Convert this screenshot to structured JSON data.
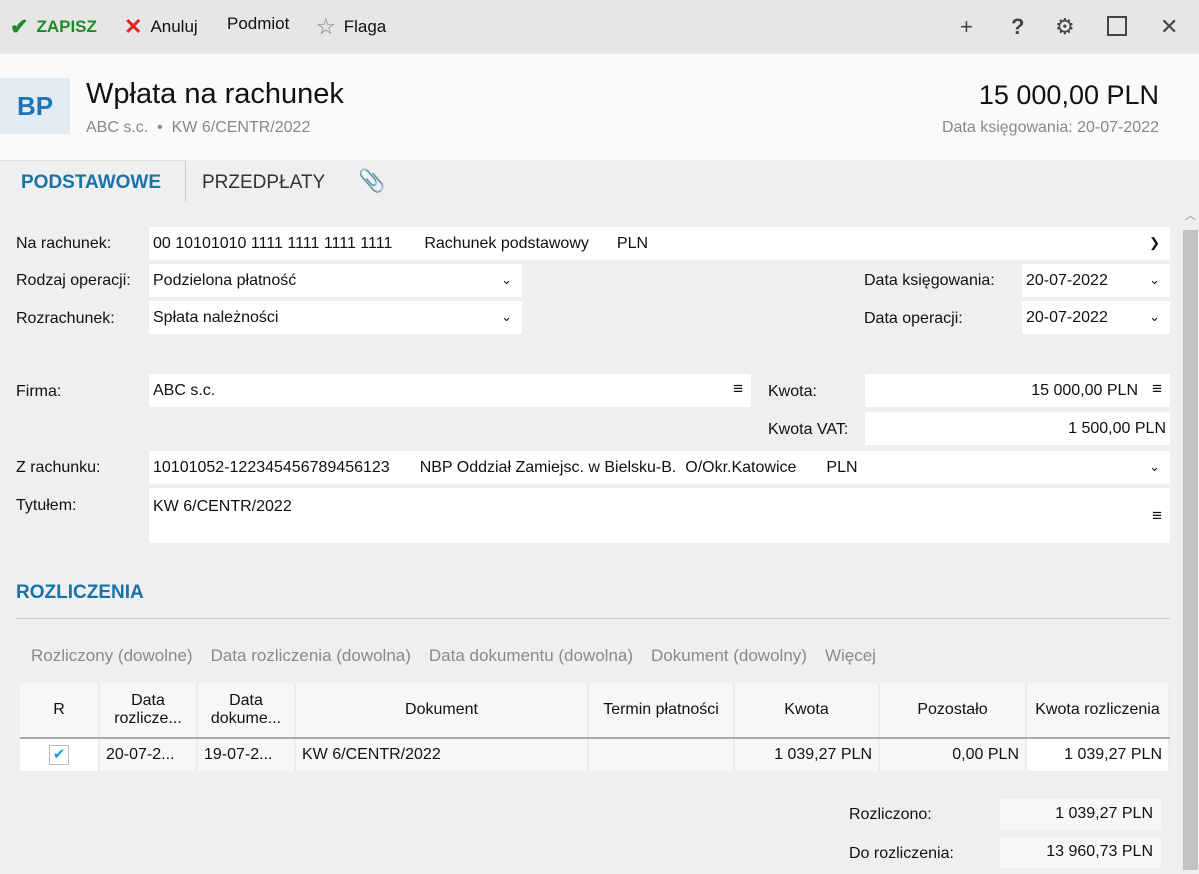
{
  "toolbar": {
    "save": "ZAPISZ",
    "cancel": "Anuluj",
    "subject": "Podmiot",
    "flag": "Flaga"
  },
  "header": {
    "badge": "BP",
    "title": "Wpłata na rachunek",
    "company": "ABC s.c.",
    "doc_number": "KW 6/CENTR/2022",
    "amount": "15 000,00 PLN",
    "posting_date": "Data księgowania: 20-07-2022"
  },
  "tabs": [
    "PODSTAWOWE",
    "PRZEDPŁATY"
  ],
  "form": {
    "account_label": "Na rachunek:",
    "account_number": "00 10101010 1111 1111 1111 1111",
    "account_name": "Rachunek podstawowy",
    "account_currency": "PLN",
    "operation_label": "Rodzaj operacji:",
    "operation_value": "Podzielona płatność",
    "settlement_label": "Rozrachunek:",
    "settlement_value": "Spłata należności",
    "posting_date_label": "Data księgowania:",
    "posting_date_value": "20-07-2022",
    "operation_date_label": "Data operacji:",
    "operation_date_value": "20-07-2022",
    "company_label": "Firma:",
    "company_value": "ABC s.c.",
    "amount_label": "Kwota:",
    "amount_value": "15 000,00 PLN",
    "vat_label": "Kwota VAT:",
    "vat_value": "1 500,00 PLN",
    "from_account_label": "Z rachunku:",
    "from_account_number": "10101052-122345456789456123",
    "from_account_bank": "NBP Oddział Zamiejsc. w Bielsku-B.  O/Okr.Katowice",
    "from_account_currency": "PLN",
    "title_label": "Tytułem:",
    "title_value": "KW 6/CENTR/2022"
  },
  "settlements": {
    "heading": "ROZLICZENIA",
    "filters": [
      "Rozliczony (dowolne)",
      "Data rozliczenia (dowolna)",
      "Data dokumentu (dowolna)",
      "Dokument (dowolny)",
      "Więcej"
    ],
    "columns": [
      "R",
      "Data rozlicze...",
      "Data dokume...",
      "Dokument",
      "Termin płatności",
      "Kwota",
      "Pozostało",
      "Kwota rozliczenia"
    ],
    "rows": [
      {
        "checked": true,
        "settle_date": "20-07-2...",
        "doc_date": "19-07-2...",
        "document": "KW 6/CENTR/2022",
        "due": "",
        "amount": "1 039,27 PLN",
        "remaining": "0,00 PLN",
        "settled": "1 039,27 PLN"
      }
    ],
    "settled_label": "Rozliczono:",
    "settled_value": "1 039,27 PLN",
    "to_settle_label": "Do rozliczenia:",
    "to_settle_value": "13 960,73 PLN"
  }
}
